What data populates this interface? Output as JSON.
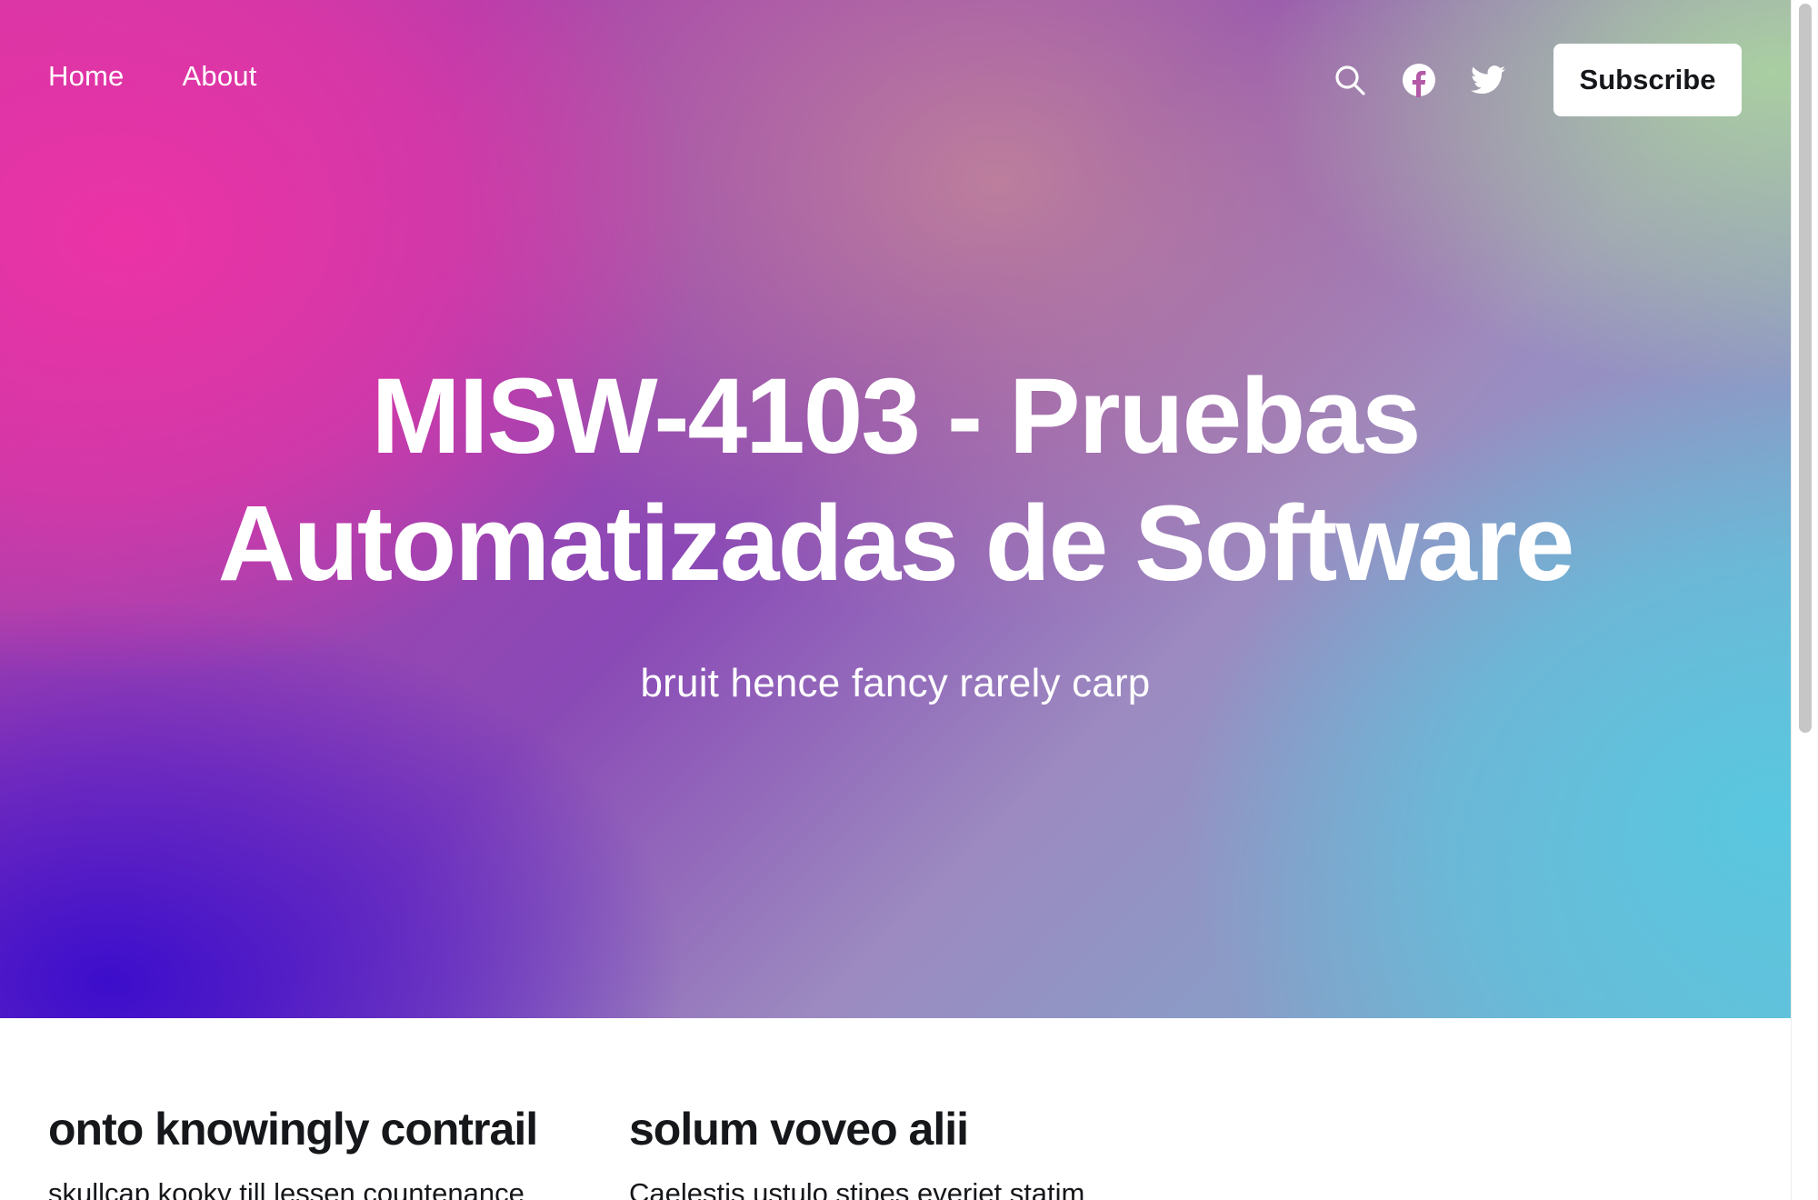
{
  "nav": {
    "links": [
      {
        "label": "Home"
      },
      {
        "label": "About"
      }
    ],
    "icons": [
      "search-icon",
      "facebook-icon",
      "twitter-icon"
    ],
    "subscribe_label": "Subscribe"
  },
  "hero": {
    "title_line1": "MISW-4103 - Pruebas",
    "title_line2": "Automatizadas de Software",
    "subtitle": "bruit hence fancy rarely carp"
  },
  "posts": [
    {
      "title": "onto knowingly contrail",
      "excerpt": "skullcap kooky till lessen countenance"
    },
    {
      "title": "solum voveo alii",
      "excerpt": "Caelestis ustulo stipes everiet statim"
    }
  ],
  "colors": {
    "text_dark": "#15171a",
    "hero_pink": "#ee32a5",
    "hero_blue": "#3a0ccc",
    "hero_cyan": "#58c9e1",
    "hero_green": "#aad2a0"
  }
}
